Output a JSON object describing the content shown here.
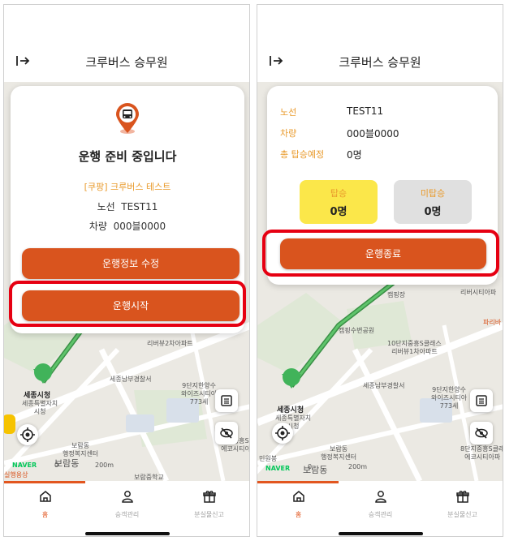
{
  "screens": [
    {
      "header": {
        "title": "크루버스 승무원"
      },
      "status_title": "운행 준비 중입니다",
      "company_line": "[쿠팡] 크루버스 테스트",
      "route_label": "노선",
      "route_value": "TEST11",
      "vehicle_label": "차량",
      "vehicle_value": "000블0000",
      "edit_button": "운행정보 수정",
      "start_button": "운행시작"
    },
    {
      "header": {
        "title": "크루버스 승무원"
      },
      "route_label": "노선",
      "route_value": "TEST11",
      "vehicle_label": "차량",
      "vehicle_value": "000블0000",
      "planned_label": "총 탑승예정",
      "planned_value": "0명",
      "boarded_label": "탑승",
      "boarded_value": "0명",
      "not_boarded_label": "미탑승",
      "not_boarded_value": "0명",
      "end_button": "운행종료"
    }
  ],
  "map": {
    "labels": {
      "city_hall": "세종시청",
      "city_hall_sub": "세종특별자치\n시청",
      "police": "세종남부경찰서",
      "apt9": "9단지한양수자인\n와이즈시티아파트\n773세대",
      "apt9_short": "9단지한양수\n와이즈시티아\n773세",
      "apt8": "8단지중흥S클래\n에코시티아파",
      "welfare": "보람동\n행정복지센터",
      "boram": "보람동",
      "school": "보람중학교",
      "scale": "200m",
      "scale_zero": "0",
      "naver": "NAVER",
      "riverview": "리버뷰2차아파트",
      "park": "캠핑수변공원",
      "camp": "캠핑장",
      "apt10": "10단지중흥S클래스\n리버뷰1차아파트",
      "paris": "파리바",
      "riverv2": "리버시티아파",
      "sejong_small": "실행용상",
      "civil": "민원봉"
    }
  },
  "tabs": [
    {
      "label": "홈",
      "icon": "home-icon"
    },
    {
      "label": "승객관리",
      "icon": "person-icon"
    },
    {
      "label": "분실물신고",
      "icon": "gift-icon"
    }
  ],
  "colors": {
    "accent": "#d9541e",
    "highlight": "#e60012",
    "boarded_bg": "#fbe74a",
    "not_boarded_bg": "#e0e0e0"
  }
}
